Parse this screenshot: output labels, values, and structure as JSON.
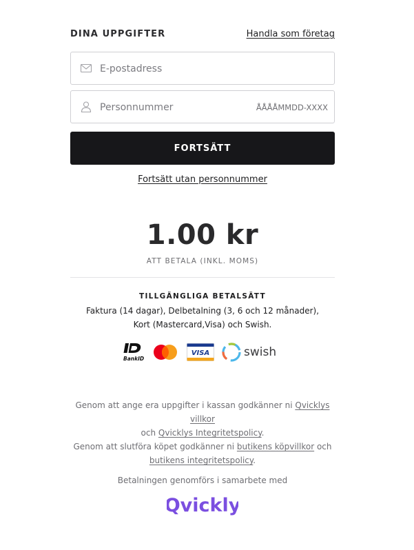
{
  "details": {
    "title": "DINA UPPGIFTER",
    "business_link": "Handla som företag"
  },
  "form": {
    "email_placeholder": "E-postadress",
    "ssn_placeholder": "Personnummer",
    "ssn_format_hint": "ÅÅÅÅMMDD-XXXX",
    "continue_label": "FORTSÄTT",
    "continue_without_ssn": "Fortsätt utan personnummer"
  },
  "summary": {
    "amount": "1.00 kr",
    "amount_label": "ATT BETALA (INKL. MOMS)"
  },
  "payment_methods": {
    "title": "TILLGÄNGLIGA BETALSÄTT",
    "description": "Faktura (14 dagar), Delbetalning (3, 6 och 12 månader), Kort (Mastercard,Visa) och Swish.",
    "logos": [
      "BankID",
      "Mastercard",
      "VISA",
      "swish"
    ]
  },
  "legal": {
    "line1_prefix": "Genom att ange era uppgifter i kassan godkänner ni ",
    "terms_link": "Qvicklys villkor",
    "line1_och": "och ",
    "privacy_link": "Qvicklys Integritetspolicy",
    "line1_end": ".",
    "line2_prefix": "Genom att slutföra köpet godkänner ni ",
    "store_terms_link": "butikens köpvillkor",
    "line2_och": " och",
    "store_privacy_link": "butikens integritetspolicy",
    "line2_end": "."
  },
  "footer": {
    "partner_text": "Betalningen genomförs i samarbete med",
    "brand": "Qvickly"
  },
  "colors": {
    "primary_button": "#17171a",
    "brand": "#7b4fe0"
  }
}
